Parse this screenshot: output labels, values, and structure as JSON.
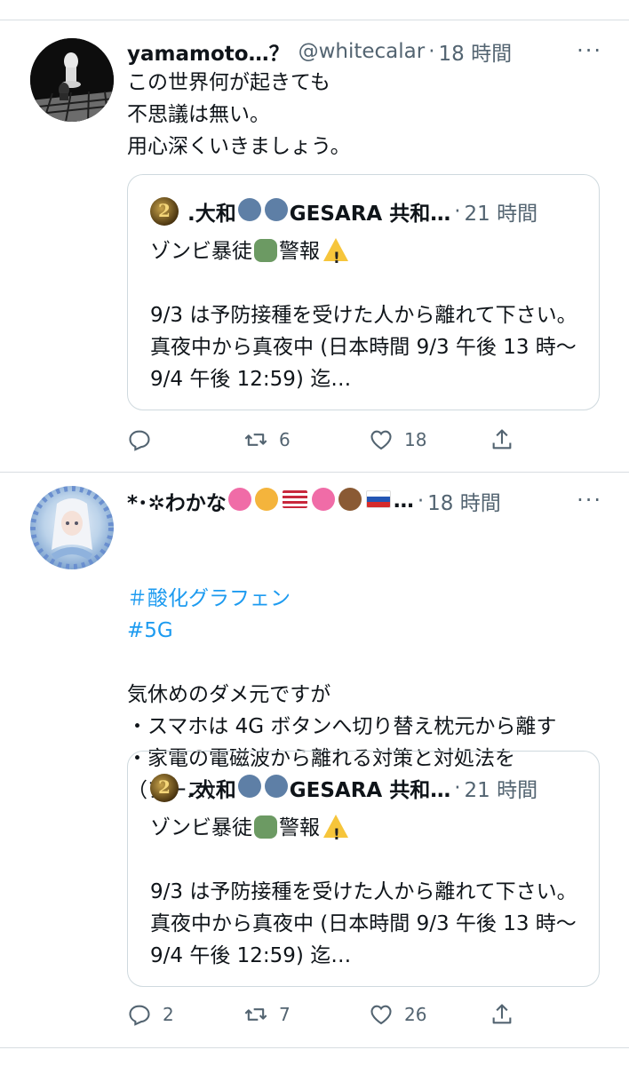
{
  "tweets": [
    {
      "name": "yamamoto…？",
      "handle": "@whitecalar",
      "dot": "·",
      "time": "18 時間",
      "more": "···",
      "text": "この世界何が起きても\n不思議は無い。\n用心深くいきましょう。",
      "quote": {
        "name_a": ".大和",
        "name_b": "GESARA 共和…",
        "dot": "·",
        "time": "21 時間",
        "line1": "ゾンビ暴徒",
        "line1_b": "警報",
        "text": "9/3 は予防接種を受けた人から離れて下さい。真夜中から真夜中 (日本時間 9/3 午後 13 時〜9/4 午後 12:59) 迄…"
      },
      "actions": {
        "reply": "",
        "retweet": "6",
        "like": "18"
      }
    },
    {
      "name": "*･✲わかな",
      "name_tail": "…",
      "dot": "·",
      "time": "18 時間",
      "more": "···",
      "hashtags": [
        "＃酸化グラフェン",
        "#5G"
      ],
      "text": "気休めのダメ元ですが\n・スマホは 4G ボタンへ切り替え枕元から離す\n・家電の電磁波から離れる対策と対処法を\n（アース）",
      "quote": {
        "name_a": ".大和",
        "name_b": "GESARA 共和…",
        "dot": "·",
        "time": "21 時間",
        "line1": "ゾンビ暴徒",
        "line1_b": "警報",
        "text": "9/3 は予防接種を受けた人から離れて下さい。真夜中から真夜中 (日本時間 9/3 午後 13 時〜9/4 午後 12:59) 迄…"
      },
      "actions": {
        "reply": "2",
        "retweet": "7",
        "like": "26"
      }
    }
  ]
}
